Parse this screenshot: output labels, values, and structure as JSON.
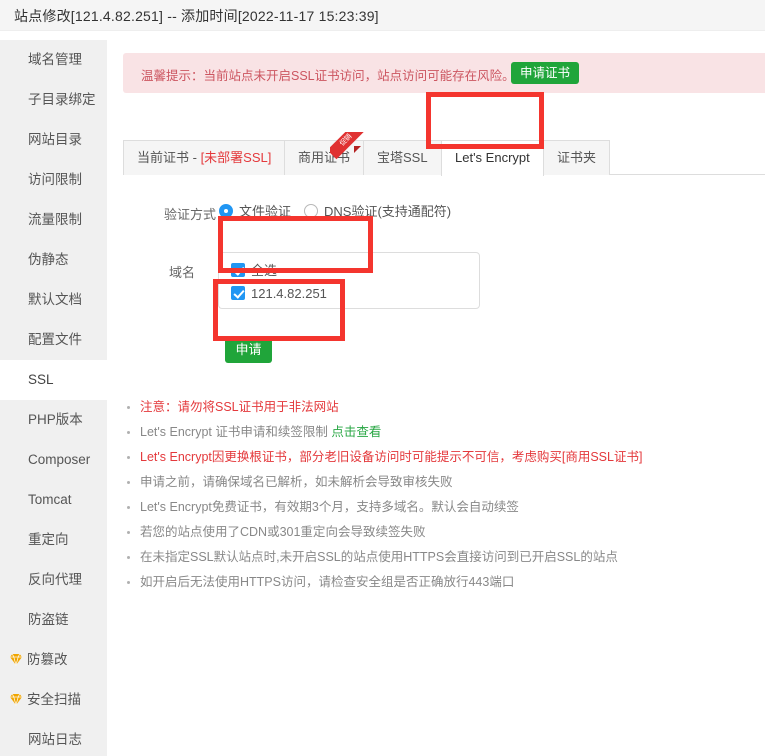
{
  "header": {
    "title": "站点修改[121.4.82.251] -- 添加时间[2022-11-17 15:23:39]"
  },
  "sidebar": {
    "items": [
      {
        "label": "域名管理",
        "icon": "",
        "active": false
      },
      {
        "label": "子目录绑定",
        "icon": "",
        "active": false
      },
      {
        "label": "网站目录",
        "icon": "",
        "active": false
      },
      {
        "label": "访问限制",
        "icon": "",
        "active": false
      },
      {
        "label": "流量限制",
        "icon": "",
        "active": false
      },
      {
        "label": "伪静态",
        "icon": "",
        "active": false
      },
      {
        "label": "默认文档",
        "icon": "",
        "active": false
      },
      {
        "label": "配置文件",
        "icon": "",
        "active": false
      },
      {
        "label": "SSL",
        "icon": "",
        "active": true
      },
      {
        "label": "PHP版本",
        "icon": "",
        "active": false
      },
      {
        "label": "Composer",
        "icon": "",
        "active": false
      },
      {
        "label": "Tomcat",
        "icon": "",
        "active": false
      },
      {
        "label": "重定向",
        "icon": "",
        "active": false
      },
      {
        "label": "反向代理",
        "icon": "",
        "active": false
      },
      {
        "label": "防盗链",
        "icon": "",
        "active": false
      },
      {
        "label": "防篡改",
        "icon": "gem-icon",
        "active": false
      },
      {
        "label": "安全扫描",
        "icon": "gem-icon",
        "active": false
      },
      {
        "label": "网站日志",
        "icon": "",
        "active": false
      }
    ]
  },
  "banner": {
    "text": "温馨提示：当前站点未开启SSL证书访问，站点访问可能存在风险。",
    "button_label": "申请证书",
    "bg_color": "#f9e3e5",
    "text_color": "#cc5560",
    "button_color": "#20a53a"
  },
  "tabs": [
    {
      "label": "当前证书 - ",
      "suffix": "[未部署SSL]",
      "active": false,
      "ribbon": ""
    },
    {
      "label": "商用证书",
      "suffix": "",
      "active": false,
      "ribbon": "促销"
    },
    {
      "label": "宝塔SSL",
      "suffix": "",
      "active": false,
      "ribbon": ""
    },
    {
      "label": "Let's Encrypt",
      "suffix": "",
      "active": true,
      "ribbon": ""
    },
    {
      "label": "证书夹",
      "suffix": "",
      "active": false,
      "ribbon": ""
    }
  ],
  "form": {
    "verify_label": "验证方式",
    "verify_options": [
      {
        "label": "文件验证",
        "checked": true
      },
      {
        "label": "DNS验证(支持通配符)",
        "checked": false
      }
    ],
    "domain_label": "域名",
    "domains": [
      {
        "label": "全选",
        "checked": true
      },
      {
        "label": "121.4.82.251",
        "checked": true
      }
    ],
    "apply_label": "申请"
  },
  "notes": [
    {
      "text": "注意：请勿将SSL证书用于非法网站",
      "style": "red"
    },
    {
      "text": "Let's Encrypt 证书申请和续签限制 ",
      "style": "gray",
      "link": "点击查看"
    },
    {
      "text": "Let's Encrypt因更换根证书，部分老旧设备访问时可能提示不可信，考虑购买[商用SSL证书]",
      "style": "red"
    },
    {
      "text": "申请之前，请确保域名已解析，如未解析会导致审核失败",
      "style": "gray"
    },
    {
      "text": "Let's Encrypt免费证书，有效期3个月，支持多域名。默认会自动续签",
      "style": "gray"
    },
    {
      "text": "若您的站点使用了CDN或301重定向会导致续签失败",
      "style": "gray"
    },
    {
      "text": "在未指定SSL默认站点时,未开启SSL的站点使用HTTPS会直接访问到已开启SSL的站点",
      "style": "gray"
    },
    {
      "text": "如开启后无法使用HTTPS访问，请检查安全组是否正确放行443端口",
      "style": "gray"
    }
  ],
  "annotations": {
    "color": "#f4352e",
    "targets": [
      "lets-encrypt-tab",
      "domain-checkbox-list",
      "apply-button"
    ]
  }
}
